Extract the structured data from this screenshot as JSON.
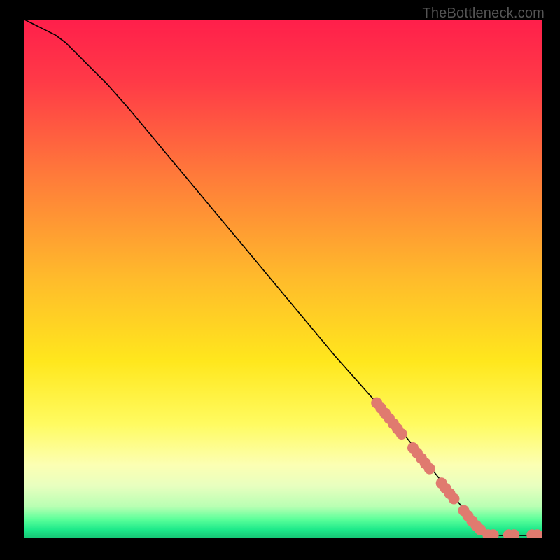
{
  "watermark": "TheBottleneck.com",
  "chart_data": {
    "type": "line",
    "title": "",
    "xlabel": "",
    "ylabel": "",
    "xlim": [
      0,
      100
    ],
    "ylim": [
      0,
      100
    ],
    "grid": false,
    "background_gradient": {
      "stops": [
        {
          "offset": 0.0,
          "color": "#ff1f4b"
        },
        {
          "offset": 0.12,
          "color": "#ff3a47"
        },
        {
          "offset": 0.3,
          "color": "#ff7a3a"
        },
        {
          "offset": 0.5,
          "color": "#ffbb2b"
        },
        {
          "offset": 0.66,
          "color": "#ffe71d"
        },
        {
          "offset": 0.78,
          "color": "#fffb60"
        },
        {
          "offset": 0.86,
          "color": "#fcffb3"
        },
        {
          "offset": 0.9,
          "color": "#e8ffbf"
        },
        {
          "offset": 0.94,
          "color": "#b9ffb3"
        },
        {
          "offset": 0.965,
          "color": "#5bff9a"
        },
        {
          "offset": 0.985,
          "color": "#1de98a"
        },
        {
          "offset": 1.0,
          "color": "#17c877"
        }
      ]
    },
    "series": [
      {
        "name": "bottleneck-curve",
        "stroke": "#000000",
        "stroke_width": 1.6,
        "x": [
          0,
          2,
          4,
          6,
          8,
          10,
          12,
          14,
          16,
          20,
          30,
          40,
          50,
          60,
          68,
          72,
          76,
          80,
          84,
          86,
          88,
          89,
          90,
          92,
          94,
          96,
          98,
          100
        ],
        "values": [
          100,
          99,
          98,
          97,
          95.5,
          93.5,
          91.5,
          89.5,
          87.5,
          83,
          71,
          59,
          47,
          35,
          26,
          21.5,
          16.5,
          11.5,
          6.5,
          4,
          2,
          1,
          0.5,
          0.4,
          0.4,
          0.4,
          0.4,
          0.4
        ]
      }
    ],
    "marker_clusters": [
      {
        "name": "cluster-upper",
        "color": "#e07a6f",
        "radius": 8,
        "points": [
          {
            "x": 68.0,
            "y": 26.0
          },
          {
            "x": 68.8,
            "y": 25.0
          },
          {
            "x": 69.6,
            "y": 24.0
          },
          {
            "x": 70.4,
            "y": 23.0
          },
          {
            "x": 71.2,
            "y": 22.0
          },
          {
            "x": 72.0,
            "y": 21.0
          },
          {
            "x": 72.8,
            "y": 20.0
          },
          {
            "x": 75.0,
            "y": 17.3
          },
          {
            "x": 75.8,
            "y": 16.3
          },
          {
            "x": 76.6,
            "y": 15.3
          },
          {
            "x": 77.4,
            "y": 14.3
          },
          {
            "x": 78.2,
            "y": 13.3
          },
          {
            "x": 80.5,
            "y": 10.5
          },
          {
            "x": 81.3,
            "y": 9.5
          },
          {
            "x": 82.1,
            "y": 8.5
          },
          {
            "x": 82.9,
            "y": 7.5
          },
          {
            "x": 84.8,
            "y": 5.2
          },
          {
            "x": 85.6,
            "y": 4.2
          },
          {
            "x": 86.4,
            "y": 3.2
          },
          {
            "x": 87.2,
            "y": 2.3
          },
          {
            "x": 88.0,
            "y": 1.5
          }
        ]
      },
      {
        "name": "cluster-flat",
        "color": "#e07a6f",
        "radius": 8,
        "points": [
          {
            "x": 89.5,
            "y": 0.5
          },
          {
            "x": 90.5,
            "y": 0.5
          },
          {
            "x": 93.5,
            "y": 0.5
          },
          {
            "x": 94.5,
            "y": 0.5
          },
          {
            "x": 98.0,
            "y": 0.5
          },
          {
            "x": 99.0,
            "y": 0.5
          }
        ]
      }
    ]
  }
}
